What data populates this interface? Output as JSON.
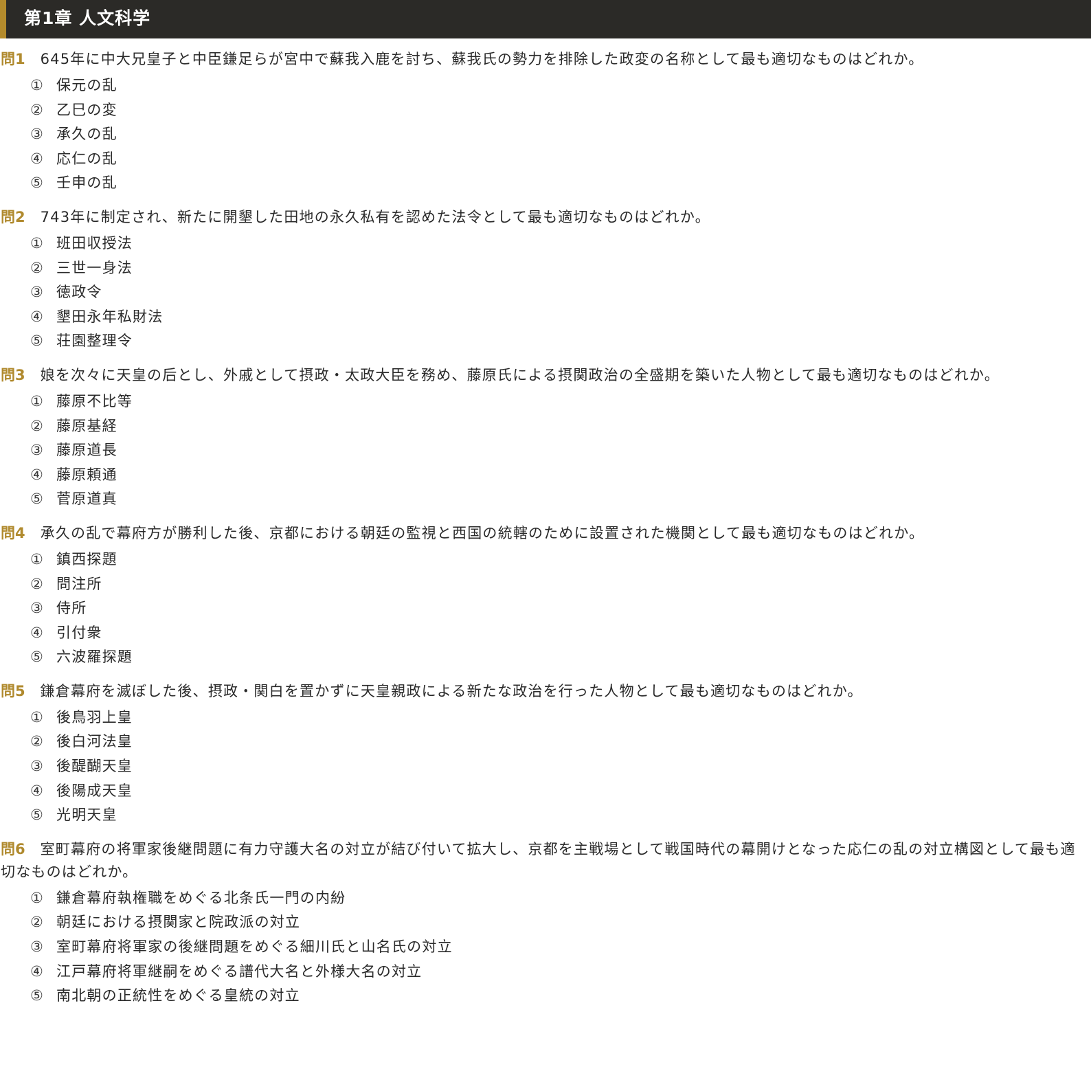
{
  "chapter": {
    "title": "第1章 人文科学"
  },
  "questions": [
    {
      "number": "問1",
      "text": "645年に中大兄皇子と中臣鎌足らが宮中で蘇我入鹿を討ち、蘇我氏の勢力を排除した政変の名称として最も適切なものはどれか。",
      "choices": [
        {
          "num": "①",
          "text": "保元の乱"
        },
        {
          "num": "②",
          "text": "乙巳の変"
        },
        {
          "num": "③",
          "text": "承久の乱"
        },
        {
          "num": "④",
          "text": "応仁の乱"
        },
        {
          "num": "⑤",
          "text": "壬申の乱"
        }
      ]
    },
    {
      "number": "問2",
      "text": "743年に制定され、新たに開墾した田地の永久私有を認めた法令として最も適切なものはどれか。",
      "choices": [
        {
          "num": "①",
          "text": "班田収授法"
        },
        {
          "num": "②",
          "text": "三世一身法"
        },
        {
          "num": "③",
          "text": "徳政令"
        },
        {
          "num": "④",
          "text": "墾田永年私財法"
        },
        {
          "num": "⑤",
          "text": "荘園整理令"
        }
      ]
    },
    {
      "number": "問3",
      "text": "娘を次々に天皇の后とし、外戚として摂政・太政大臣を務め、藤原氏による摂関政治の全盛期を築いた人物として最も適切なものはどれか。",
      "choices": [
        {
          "num": "①",
          "text": "藤原不比等"
        },
        {
          "num": "②",
          "text": "藤原基経"
        },
        {
          "num": "③",
          "text": "藤原道長"
        },
        {
          "num": "④",
          "text": "藤原頼通"
        },
        {
          "num": "⑤",
          "text": "菅原道真"
        }
      ]
    },
    {
      "number": "問4",
      "text": "承久の乱で幕府方が勝利した後、京都における朝廷の監視と西国の統轄のために設置された機関として最も適切なものはどれか。",
      "choices": [
        {
          "num": "①",
          "text": "鎮西探題"
        },
        {
          "num": "②",
          "text": "問注所"
        },
        {
          "num": "③",
          "text": "侍所"
        },
        {
          "num": "④",
          "text": "引付衆"
        },
        {
          "num": "⑤",
          "text": "六波羅探題"
        }
      ]
    },
    {
      "number": "問5",
      "text": "鎌倉幕府を滅ぼした後、摂政・関白を置かずに天皇親政による新たな政治を行った人物として最も適切なものはどれか。",
      "choices": [
        {
          "num": "①",
          "text": "後鳥羽上皇"
        },
        {
          "num": "②",
          "text": "後白河法皇"
        },
        {
          "num": "③",
          "text": "後醍醐天皇"
        },
        {
          "num": "④",
          "text": "後陽成天皇"
        },
        {
          "num": "⑤",
          "text": "光明天皇"
        }
      ]
    },
    {
      "number": "問6",
      "text": "室町幕府の将軍家後継問題に有力守護大名の対立が結び付いて拡大し、京都を主戦場として戦国時代の幕開けとなった応仁の乱の対立構図として最も適切なものはどれか。",
      "choices": [
        {
          "num": "①",
          "text": "鎌倉幕府執権職をめぐる北条氏一門の内紛"
        },
        {
          "num": "②",
          "text": "朝廷における摂関家と院政派の対立"
        },
        {
          "num": "③",
          "text": "室町幕府将軍家の後継問題をめぐる細川氏と山名氏の対立"
        },
        {
          "num": "④",
          "text": "江戸幕府将軍継嗣をめぐる譜代大名と外様大名の対立"
        },
        {
          "num": "⑤",
          "text": "南北朝の正統性をめぐる皇統の対立"
        }
      ]
    }
  ]
}
